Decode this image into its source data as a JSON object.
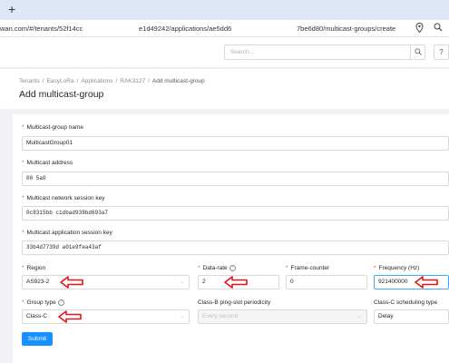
{
  "browser": {
    "new_tab": "+",
    "url_part1": "wan.com/#/tenants/52f14cc",
    "url_part2": "e1d49242/applications/ae5dd6",
    "url_part3": "7be6d80/multicast-groups/create"
  },
  "header": {
    "search_placeholder": "Search...",
    "search_icon": "search-icon",
    "help_label": "?"
  },
  "breadcrumb": {
    "items": [
      "Tenants",
      "EasyLoRa",
      "Applications",
      "RAK3127"
    ],
    "current": "Add multicast-group",
    "separator": "/"
  },
  "page_title": "Add multicast-group",
  "form": {
    "name": {
      "label": "Multicast-group name",
      "value": "MulticastGroup01"
    },
    "address": {
      "label": "Multicast address",
      "value": "00   5a0"
    },
    "nwk_key": {
      "label": "Multicast network session key",
      "value": "0c8315bb            c1dbad938bd693a7"
    },
    "app_key": {
      "label": "Multicast application session key",
      "value": "33b4d7739d            a01e9fea43af"
    },
    "region": {
      "label": "Region",
      "value": "AS923-2"
    },
    "data_rate": {
      "label": "Data-rate",
      "value": "2"
    },
    "frame_counter": {
      "label": "Frame-counter",
      "value": "0"
    },
    "frequency": {
      "label": "Frequency (Hz)",
      "value": "921400000"
    },
    "group_type": {
      "label": "Group type",
      "value": "Class-C"
    },
    "ping_slot": {
      "label": "Class-B ping-slot periodicity",
      "value": "Every second"
    },
    "scheduling": {
      "label": "Class-C scheduling type",
      "value": "Delay"
    },
    "required_mark": "*",
    "help_mark": "?",
    "submit_label": "Submit"
  },
  "colors": {
    "primary": "#1890ff",
    "required": "#ff4d4f",
    "annotation_arrow": "#e3161b"
  }
}
